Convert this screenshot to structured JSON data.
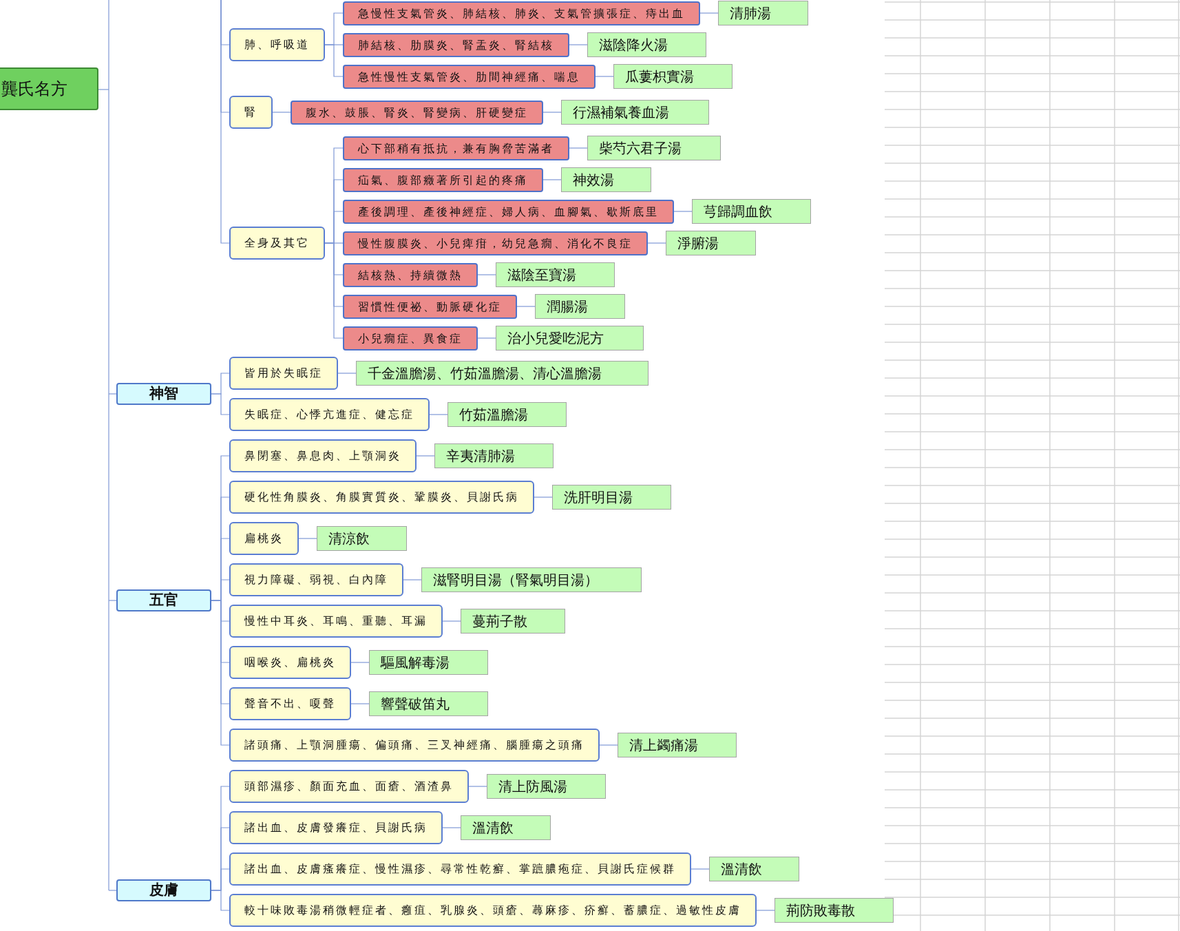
{
  "root": {
    "label": "龔氏名方"
  },
  "categories": [
    {
      "children": [
        {
          "label": "肺、呼吸道",
          "children": [
            {
              "label": "急慢性支氣管炎、肺結核、肺炎、支氣管擴張症、痔出血",
              "formula": "清肺湯"
            },
            {
              "label": "肺結核、肋膜炎、腎盂炎、腎結核",
              "formula": "滋陰降火湯"
            },
            {
              "label": "急性慢性支氣管炎、肋間神經痛、喘息",
              "formula": "瓜蔞枳實湯"
            }
          ]
        },
        {
          "label": "腎",
          "children": [
            {
              "label": "腹水、鼓脹、腎炎、腎變病、肝硬變症",
              "formula": "行濕補氣養血湯"
            }
          ]
        },
        {
          "label": "全身及其它",
          "children": [
            {
              "label": "心下部稍有抵抗，兼有胸脅苦滿者",
              "formula": "柴芍六君子湯"
            },
            {
              "label": "疝氣、腹部癥著所引起的疼痛",
              "formula": "神效湯"
            },
            {
              "label": "產後調理、產後神經症、婦人病、血腳氣、歇斯底里",
              "formula": "芎歸調血飲"
            },
            {
              "label": "慢性腹膜炎、小兒痺疳，幼兒急癇、消化不良症",
              "formula": "淨腑湯"
            },
            {
              "label": "結核熱、持續微熱",
              "formula": "滋陰至寶湯"
            },
            {
              "label": "習慣性便祕、動脈硬化症",
              "formula": "潤腸湯"
            },
            {
              "label": "小兒癇症、異食症",
              "formula": "治小兒愛吃泥方"
            }
          ]
        }
      ]
    },
    {
      "label": "神智",
      "children": [
        {
          "label": "皆用於失眠症",
          "formula": "千金溫膽湯、竹茹溫膽湯、清心溫膽湯"
        },
        {
          "label": "失眠症、心悸亢進症、健忘症",
          "formula": "竹茹溫膽湯"
        }
      ]
    },
    {
      "label": "五官",
      "children": [
        {
          "label": "鼻閉塞、鼻息肉、上顎洞炎",
          "formula": "辛夷清肺湯"
        },
        {
          "label": "硬化性角膜炎、角膜實質炎、鞏膜炎、貝謝氏病",
          "formula": "洗肝明目湯"
        },
        {
          "label": "扁桃炎",
          "formula": "清涼飲"
        },
        {
          "label": "視力障礙、弱視、白內障",
          "formula": "滋腎明目湯（腎氣明目湯）"
        },
        {
          "label": "慢性中耳炎、耳鳴、重聽、耳漏",
          "formula": "蔓荊子散"
        },
        {
          "label": "咽喉炎、扁桃炎",
          "formula": "驅風解毒湯"
        },
        {
          "label": "聲音不出、嗄聲",
          "formula": "響聲破笛丸"
        },
        {
          "label": "諸頭痛、上顎洞腫瘍、偏頭痛、三叉神經痛、腦腫瘍之頭痛",
          "formula": "清上蠲痛湯"
        }
      ]
    },
    {
      "label": "皮膚",
      "children": [
        {
          "label": "頭部濕疹、顏面充血、面瘡、酒渣鼻",
          "formula": "清上防風湯"
        },
        {
          "label": "諸出血、皮膚發癢症、貝謝氏病",
          "formula": "溫清飲"
        },
        {
          "label": "諸出血、皮膚瘙癢症、慢性濕疹、尋常性乾癬、掌蹠膿疱症、貝謝氏症候群",
          "formula": "溫清飲"
        },
        {
          "label": "較十味敗毒湯稍微輕症者、癰疽、乳腺炎、頭瘡、蕁麻疹、疥癬、蓄膿症、過敏性皮膚",
          "formula": "荊防敗毒散"
        }
      ]
    }
  ]
}
